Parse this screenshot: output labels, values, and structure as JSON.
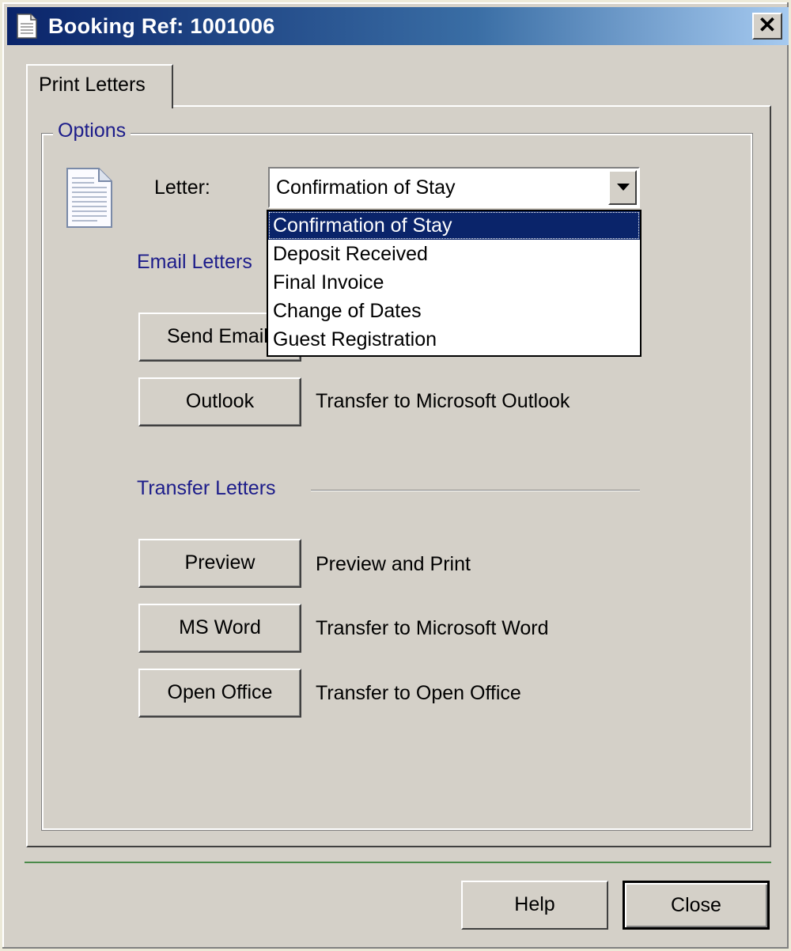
{
  "window": {
    "title": "Booking Ref: 1001006",
    "close_glyph": "✕"
  },
  "tabs": [
    {
      "label": "Print Letters",
      "active": true
    }
  ],
  "options_group": {
    "legend": "Options"
  },
  "letter": {
    "label": "Letter:",
    "selected": "Confirmation of Stay",
    "options": [
      "Confirmation of Stay",
      "Deposit Received",
      "Final Invoice",
      "Change of Dates",
      "Guest Registration"
    ],
    "selected_index": 0
  },
  "email_section": {
    "title": "Email Letters",
    "send_email_label": "Send Email",
    "outlook_label": "Outlook",
    "outlook_desc": "Transfer to Microsoft Outlook"
  },
  "transfer_section": {
    "title": "Transfer Letters",
    "preview_label": "Preview",
    "preview_desc": "Preview and Print",
    "msword_label": "MS Word",
    "msword_desc": "Transfer to Microsoft Word",
    "openoffice_label": "Open Office",
    "openoffice_desc": "Transfer to Open Office"
  },
  "footer": {
    "help_label": "Help",
    "close_label": "Close"
  },
  "colors": {
    "title_bar_start": "#0a246a",
    "title_bar_end": "#a6caf0",
    "section_text": "#1c1c8a",
    "selection": "#0a246a",
    "divider_green": "#4a8a4a"
  }
}
